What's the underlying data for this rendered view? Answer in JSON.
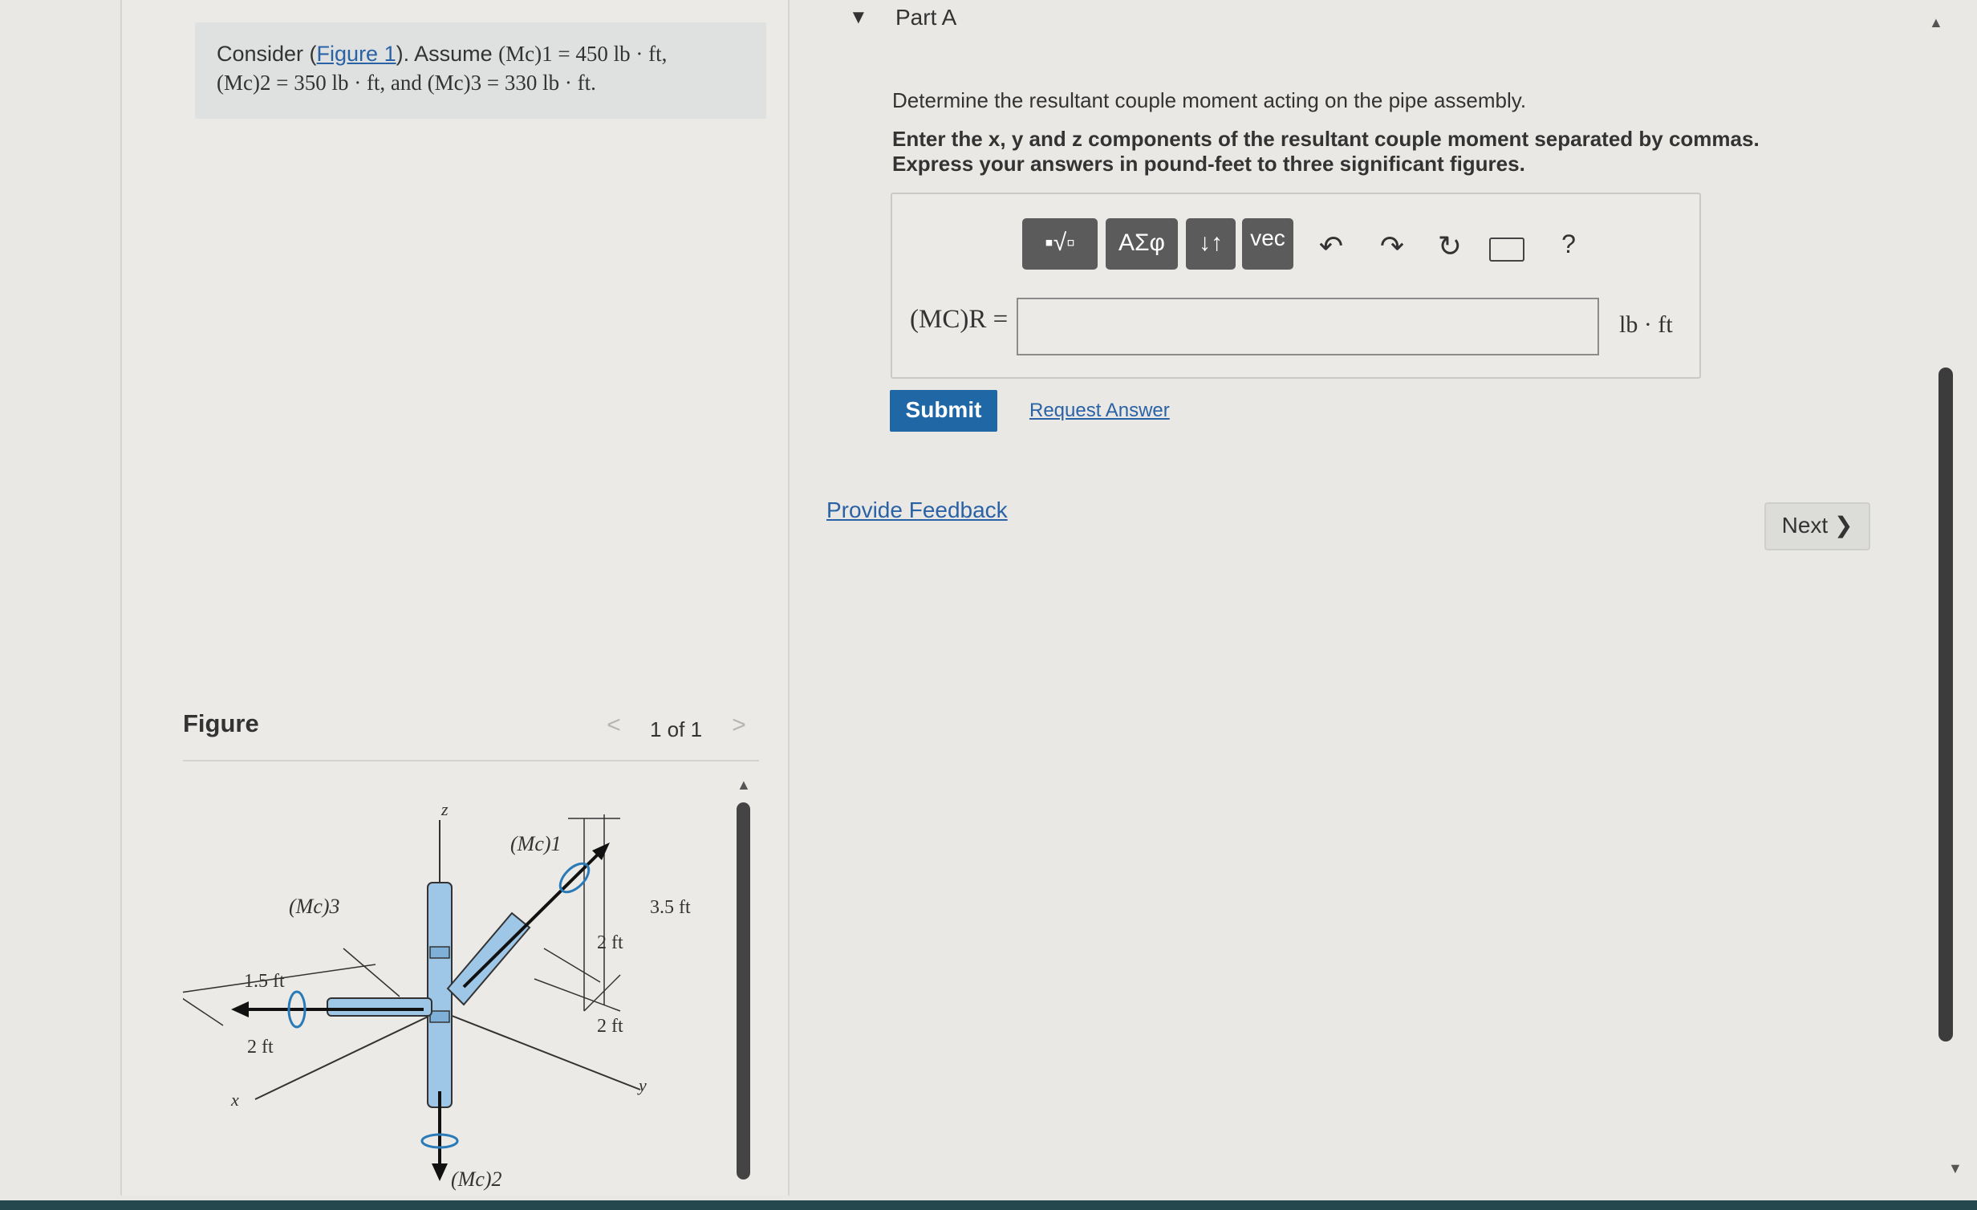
{
  "problem": {
    "line1_prefix": "Consider (",
    "figure_link": "Figure 1",
    "line1_mid": "). Assume ",
    "m1_expr": "(Mc)1 = 450 lb · ft,",
    "line2": "(Mc)2 = 350 lb · ft, and (Mc)3 = 330 lb · ft."
  },
  "figure": {
    "heading": "Figure",
    "prev_icon": "chevron-left-icon",
    "prev_glyph": "<",
    "count": "1 of 1",
    "next_icon": "chevron-right-icon",
    "next_glyph": ">",
    "labels": {
      "z": "z",
      "x": "x",
      "y": "y",
      "m1": "(Mc)1",
      "m2": "(Mc)2",
      "m3": "(Mc)3",
      "d1": "1.5 ft",
      "d2": "2 ft",
      "d3": "2 ft",
      "d4": "2 ft",
      "d5": "3.5 ft"
    }
  },
  "part": {
    "toggle_icon": "caret-down-icon",
    "toggle_glyph": "▼",
    "title": "Part A",
    "question": "Determine the resultant couple moment acting on the pipe assembly.",
    "instructions": "Enter the x, y and z components of the resultant couple moment separated by commas. Express your answers in pound-feet to three significant figures."
  },
  "toolbar": {
    "templates_label": "▪√▫",
    "greek_label": "ΑΣφ",
    "arrows_label": "↓↑",
    "vec_label": "vec",
    "undo_glyph": "↶",
    "redo_glyph": "↷",
    "reset_glyph": "↻",
    "help_glyph": "?"
  },
  "answer": {
    "label": "(MC)R =",
    "value": "",
    "unit": "lb · ft"
  },
  "actions": {
    "submit": "Submit",
    "request_answer": "Request Answer",
    "provide_feedback": "Provide Feedback",
    "next": "Next ❯"
  },
  "scroll": {
    "up_glyph": "▲",
    "down_glyph": "▼"
  }
}
